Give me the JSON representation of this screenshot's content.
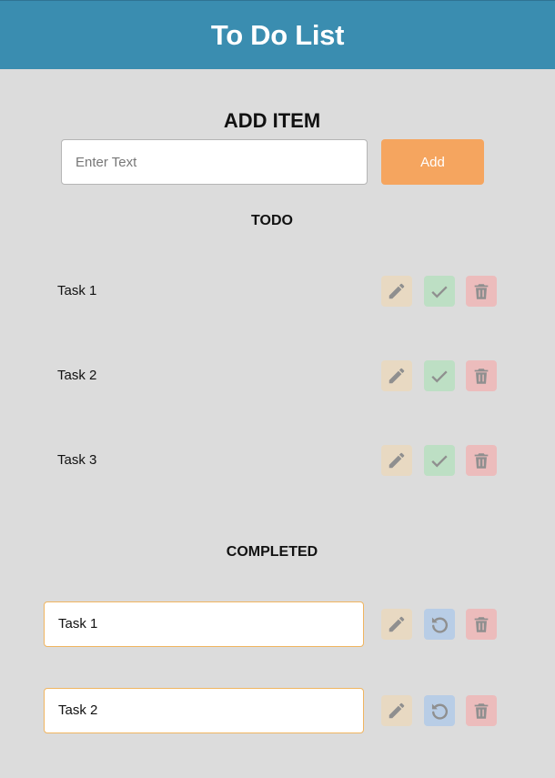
{
  "app": {
    "title": "To Do List"
  },
  "add": {
    "heading": "ADD ITEM",
    "input_placeholder": "Enter Text",
    "input_value": "",
    "button_label": "Add"
  },
  "todo": {
    "heading": "TODO",
    "items": [
      {
        "label": "Task 1"
      },
      {
        "label": "Task 2"
      },
      {
        "label": "Task 3"
      }
    ]
  },
  "completed": {
    "heading": "COMPLETED",
    "items": [
      {
        "label": "Task 1"
      },
      {
        "label": "Task 2"
      }
    ]
  },
  "icons": {
    "edit": "pencil-icon",
    "complete": "check-icon",
    "undo": "undo-icon",
    "delete": "trash-icon"
  },
  "colors": {
    "header": "#3a8db0",
    "add_button": "#f5a55f",
    "background": "#dcdcdc",
    "edit_bg": "#e8d9c2",
    "complete_bg": "#bddfc4",
    "undo_bg": "#b8cde6",
    "delete_bg": "#ecbcbc",
    "icon_fill": "#8f8f8f"
  }
}
